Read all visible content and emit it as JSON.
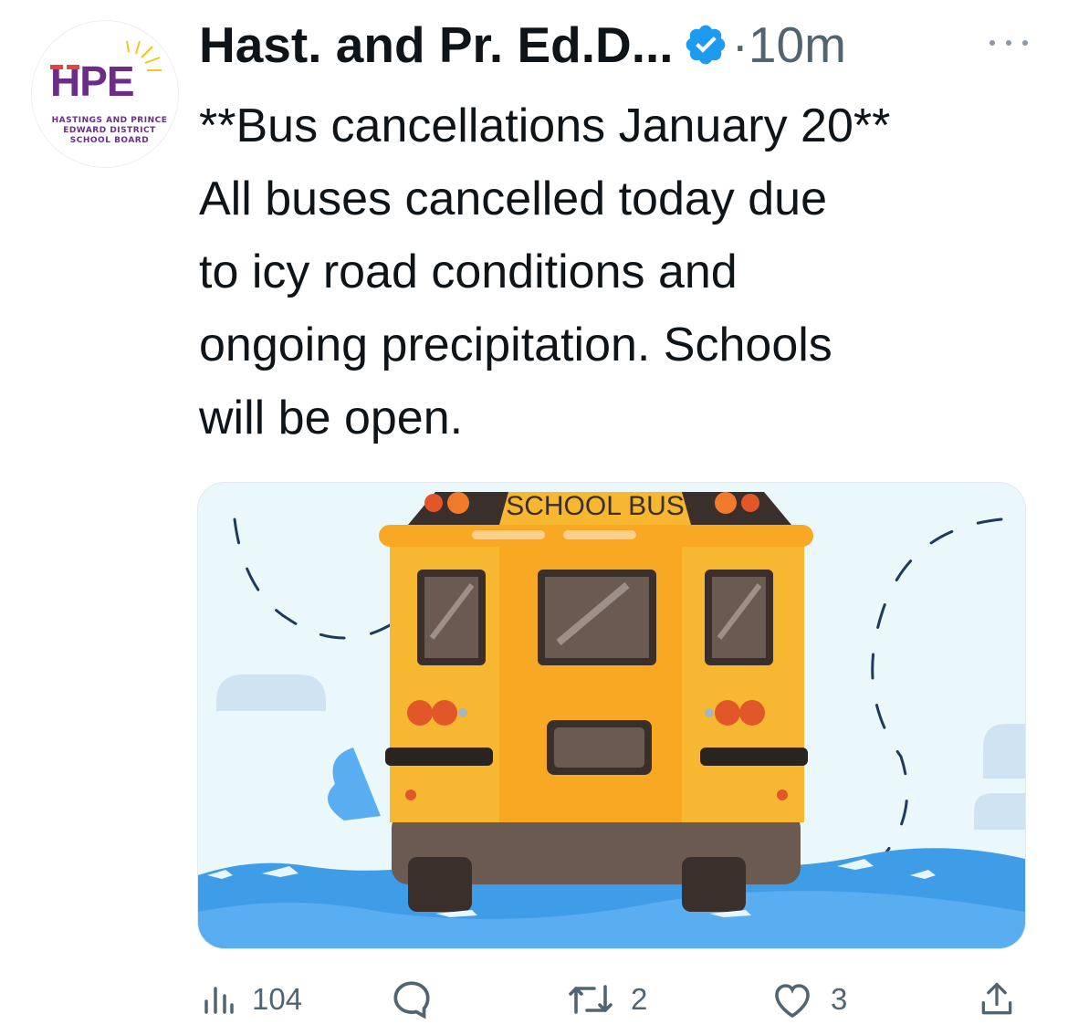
{
  "tweet": {
    "author": {
      "name": "Hast. and Pr. Ed.D...",
      "logo_text": "HPE",
      "logo_subtext": "HASTINGS AND PRINCE EDWARD DISTRICT SCHOOL BOARD",
      "verified": true
    },
    "separator": "·",
    "time": "10m",
    "more_icon": "more-dots-icon",
    "text": "**Bus cancellations January 20**\nAll buses cancelled today due\nto icy road conditions and\nongoing precipitation. Schools\nwill be open.",
    "media": {
      "sign_text": "SCHOOL BUS",
      "description_icon": "school-bus-illustration"
    },
    "actions": {
      "views": "104",
      "replies": "",
      "retweets": "2",
      "likes": "3"
    }
  },
  "colors": {
    "text_primary": "#0f1419",
    "text_secondary": "#536471",
    "verified_blue": "#1d9bf0",
    "bus_yellow": "#f7b731",
    "logo_purple": "#6b2d86"
  }
}
